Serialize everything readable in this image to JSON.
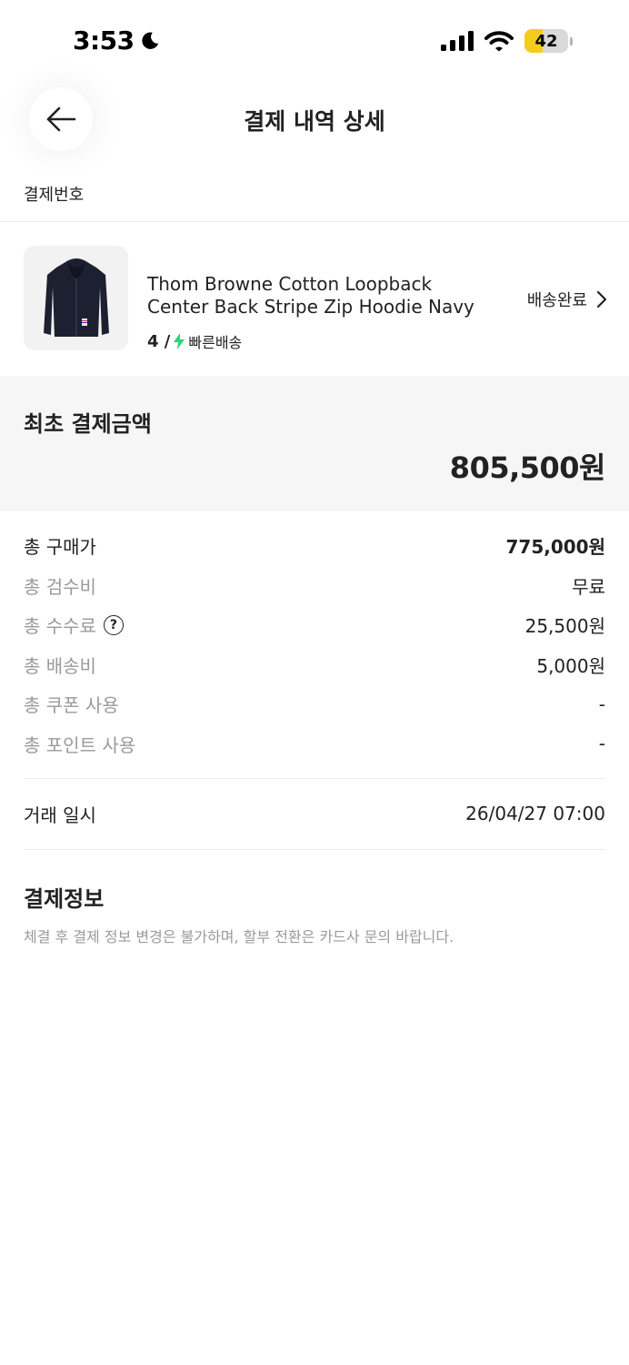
{
  "status_bar": {
    "time": "3:53",
    "battery_level": "42",
    "battery_fraction": 0.42,
    "icons": [
      "moon-icon",
      "cellular-signal-icon",
      "wifi-icon",
      "battery-icon"
    ]
  },
  "header": {
    "title": "결제 내역 상세",
    "back_icon": "arrow-left-icon"
  },
  "order": {
    "number_label": "결제번호"
  },
  "product": {
    "name": "Thom Browne Cotton Loopback Center Back Stripe Zip Hoodie Navy",
    "size": "4 /",
    "delivery_type": "빠른배송",
    "status": "배송완료",
    "accent_color": "#2fd17a"
  },
  "initial_payment": {
    "label": "최초 결제금액",
    "amount": "805,500원"
  },
  "details": [
    {
      "label": "총 구매가",
      "value": "775,000원"
    },
    {
      "label": "총 검수비",
      "value": "무료"
    },
    {
      "label": "총 수수료",
      "value": "25,500원",
      "help": "?"
    },
    {
      "label": "총 배송비",
      "value": "5,000원"
    },
    {
      "label": "총 쿠폰 사용",
      "value": "-"
    },
    {
      "label": "총 포인트 사용",
      "value": "-"
    }
  ],
  "trade": {
    "label": "거래 일시",
    "value": "26/04/27 07:00"
  },
  "payment_info": {
    "title": "결제정보",
    "description": "체결 후 결제 정보 변경은 불가하며, 할부 전환은 카드사 문의 바랍니다."
  }
}
